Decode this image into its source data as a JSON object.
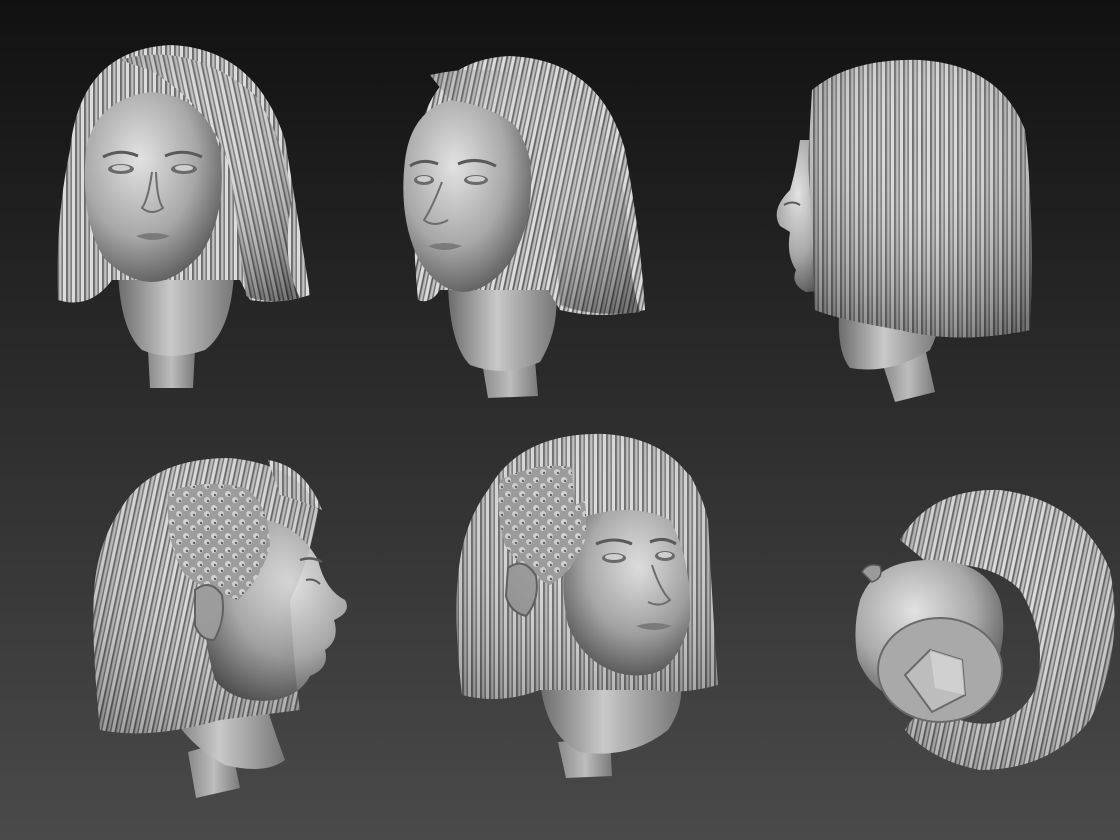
{
  "scene": {
    "background_top": "#111111",
    "background_bottom": "#4a4a4a",
    "material_light": "#d6d6d6",
    "material_mid": "#8e8e8e",
    "material_dark": "#3a3a3a"
  },
  "views": [
    {
      "view": "front",
      "icon": "head-sculpt-front-icon"
    },
    {
      "view": "three-quarter-left",
      "icon": "head-sculpt-three-quarter-icon"
    },
    {
      "view": "profile-left",
      "icon": "head-sculpt-profile-icon"
    },
    {
      "view": "profile-right",
      "icon": "head-sculpt-profile-right-icon"
    },
    {
      "view": "three-quarter-right",
      "icon": "head-sculpt-three-quarter-right-icon"
    },
    {
      "view": "bottom",
      "icon": "head-sculpt-bottom-icon"
    }
  ]
}
